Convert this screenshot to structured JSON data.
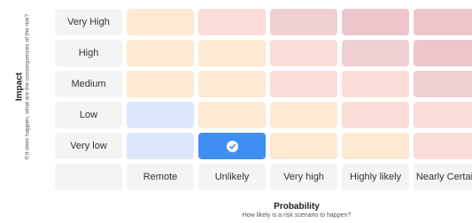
{
  "y_axis": {
    "title": "Impact",
    "subtitle": "If it does happen, what are the consequences of the risk?"
  },
  "x_axis": {
    "title": "Probability",
    "subtitle": "How likely is a risk scenario to happen?"
  },
  "impact_levels": [
    "Very High",
    "High",
    "Medium",
    "Low",
    "Very low"
  ],
  "probability_levels": [
    "Remote",
    "Unlikely",
    "Very high",
    "Highly likely",
    "Nearly Certain"
  ],
  "colors": {
    "orange_light": "#fde9d2",
    "salmon": "#fcdcd7",
    "rose": "#f0cfd2",
    "rose_dark": "#ecc6ca",
    "blue_light": "#dbe8fc",
    "blue_selected": "#3f8ff3",
    "label_bg": "#f4f4f5"
  },
  "matrix": [
    [
      "orange_light",
      "salmon",
      "rose",
      "rose_dark",
      "rose_dark"
    ],
    [
      "orange_light",
      "orange_light",
      "salmon",
      "rose",
      "rose_dark"
    ],
    [
      "orange_light",
      "orange_light",
      "salmon",
      "salmon",
      "rose"
    ],
    [
      "blue_light",
      "orange_light",
      "orange_light",
      "salmon",
      "salmon"
    ],
    [
      "blue_light",
      "blue_selected",
      "orange_light",
      "orange_light",
      "salmon"
    ]
  ],
  "selected": {
    "impact": "Very low",
    "probability": "Unlikely"
  }
}
